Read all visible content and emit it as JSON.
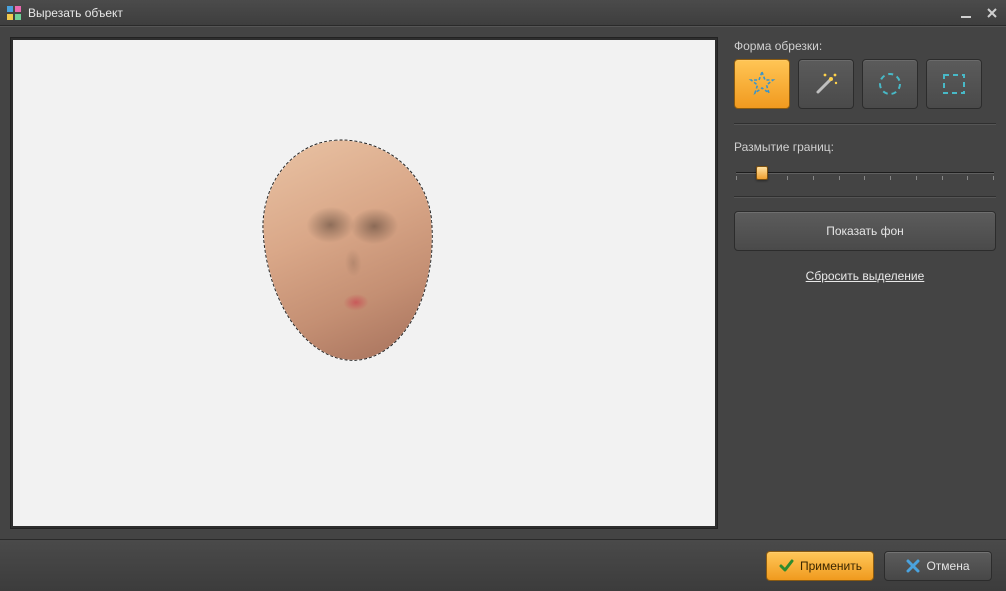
{
  "window": {
    "title": "Вырезать объект"
  },
  "side": {
    "shape_label": "Форма обрезки:",
    "blur_label": "Размытие границ:",
    "blur_value": 1,
    "blur_ticks": 11,
    "show_bg_label": "Показать фон",
    "reset_label": "Сбросить выделение",
    "tools": [
      {
        "name": "auto-star-tool",
        "active": true
      },
      {
        "name": "magic-wand-tool",
        "active": false
      },
      {
        "name": "ellipse-select-tool",
        "active": false
      },
      {
        "name": "rect-select-tool",
        "active": false
      }
    ]
  },
  "footer": {
    "apply_label": "Применить",
    "cancel_label": "Отмена"
  },
  "colors": {
    "accent": "#f5a623",
    "select_dash": "#48b9c7"
  }
}
